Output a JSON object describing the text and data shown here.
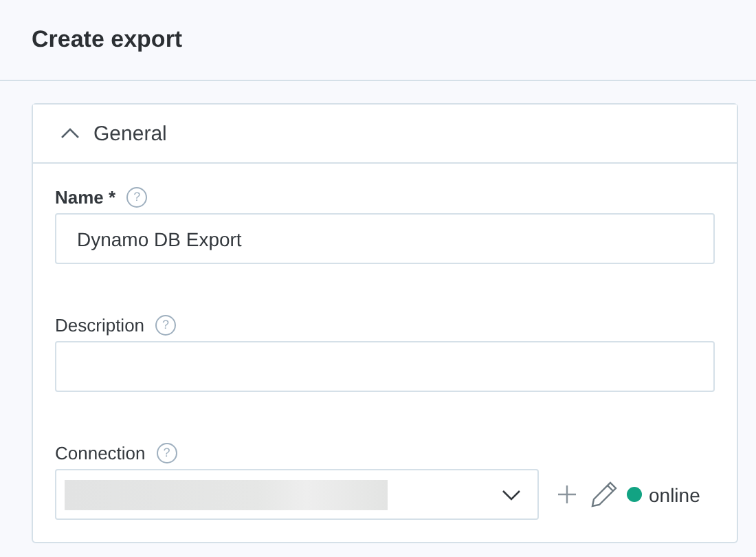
{
  "title": "Create export",
  "section": {
    "title": "General",
    "expanded": true
  },
  "fields": [
    {
      "kind": "text",
      "label": "Name",
      "required": true,
      "required_mark": "*",
      "help": "?",
      "value": "Dynamo DB Export"
    },
    {
      "kind": "text",
      "label": "Description",
      "required": false,
      "help": "?"
    },
    {
      "kind": "select",
      "label": "Connection",
      "required": false,
      "help": "?",
      "status": {
        "text": "online",
        "color": "#12a383"
      }
    }
  ]
}
